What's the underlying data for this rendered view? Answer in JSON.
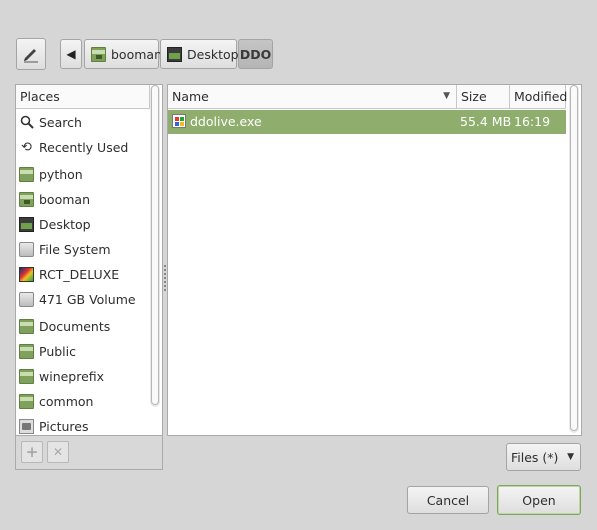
{
  "path_bar": {
    "edit_icon": "pencil-icon",
    "back_icon": "triangle-left-icon",
    "back_glyph": "◀",
    "crumbs": [
      {
        "label": "booman",
        "icon": "home-folder-icon"
      },
      {
        "label": "Desktop",
        "icon": "desktop-icon"
      },
      {
        "label": "DDO",
        "icon": null
      }
    ]
  },
  "places": {
    "header": "Places",
    "items": [
      {
        "label": "Search",
        "icon": "search-icon",
        "glyph": "🔍"
      },
      {
        "label": "Recently Used",
        "icon": "history-icon",
        "glyph": "⟲"
      },
      {
        "label": "python",
        "icon": "folder-icon"
      },
      {
        "label": "booman",
        "icon": "home-folder-icon"
      },
      {
        "label": "Desktop",
        "icon": "desktop-icon"
      },
      {
        "label": "File System",
        "icon": "drive-icon"
      },
      {
        "label": "RCT_DELUXE",
        "icon": "rct-icon"
      },
      {
        "label": "471 GB Volume",
        "icon": "drive-icon"
      },
      {
        "label": "Documents",
        "icon": "folder-icon"
      },
      {
        "label": "Public",
        "icon": "folder-icon"
      },
      {
        "label": "wineprefix",
        "icon": "folder-icon"
      },
      {
        "label": "common",
        "icon": "folder-icon"
      },
      {
        "label": "Pictures",
        "icon": "pictures-folder-icon"
      }
    ],
    "add_glyph": "+",
    "remove_glyph": "✕"
  },
  "files": {
    "columns": {
      "name": "Name",
      "size": "Size",
      "modified": "Modified"
    },
    "sort_glyph": "▼",
    "rows": [
      {
        "name": "ddolive.exe",
        "size": "55.4 MB",
        "modified": "16:19",
        "icon": "exe-icon",
        "selected": true
      }
    ]
  },
  "filter": {
    "label": "Files (*)",
    "caret": "▼"
  },
  "buttons": {
    "cancel": "Cancel",
    "open": "Open"
  },
  "colors": {
    "selection": "#8fae6e",
    "accent": "#7ea55a"
  }
}
